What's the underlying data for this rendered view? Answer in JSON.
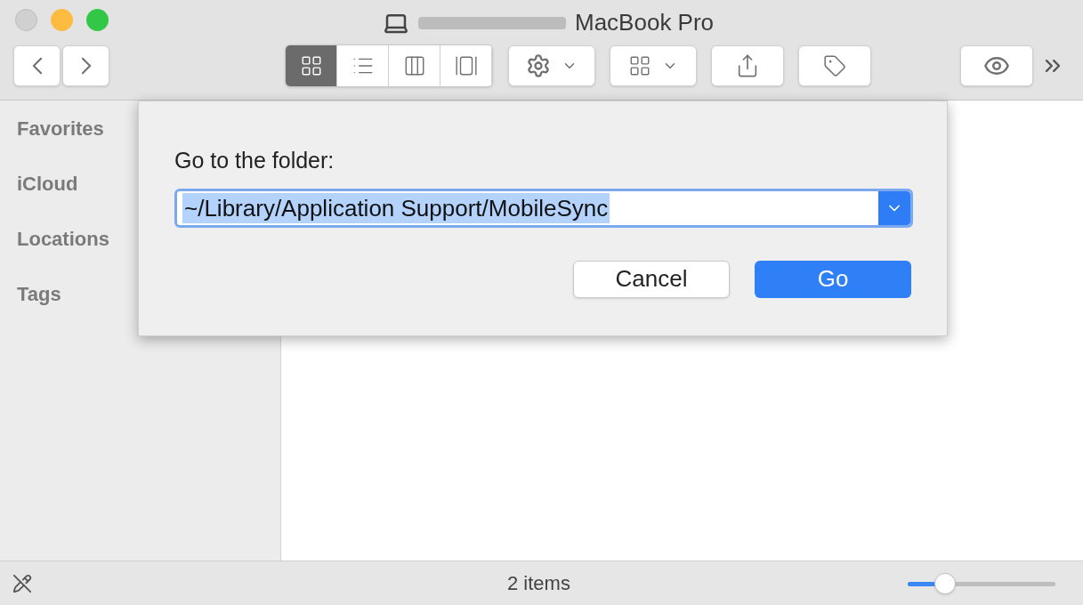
{
  "window": {
    "title": "MacBook Pro"
  },
  "toolbar": {
    "view_modes": [
      {
        "kind": "icons",
        "selected": true
      },
      {
        "kind": "list",
        "selected": false
      },
      {
        "kind": "columns",
        "selected": false
      },
      {
        "kind": "gallery",
        "selected": false
      }
    ]
  },
  "sidebar": {
    "sections": [
      "Favorites",
      "iCloud",
      "Locations",
      "Tags"
    ]
  },
  "dialog": {
    "label": "Go to the folder:",
    "value": "~/Library/Application Support/MobileSync",
    "buttons": [
      {
        "label": "Cancel",
        "kind": "secondary"
      },
      {
        "label": "Go",
        "kind": "primary"
      }
    ]
  },
  "status_bar": {
    "text": "2 items",
    "zoom": {
      "level": 0.25
    }
  }
}
